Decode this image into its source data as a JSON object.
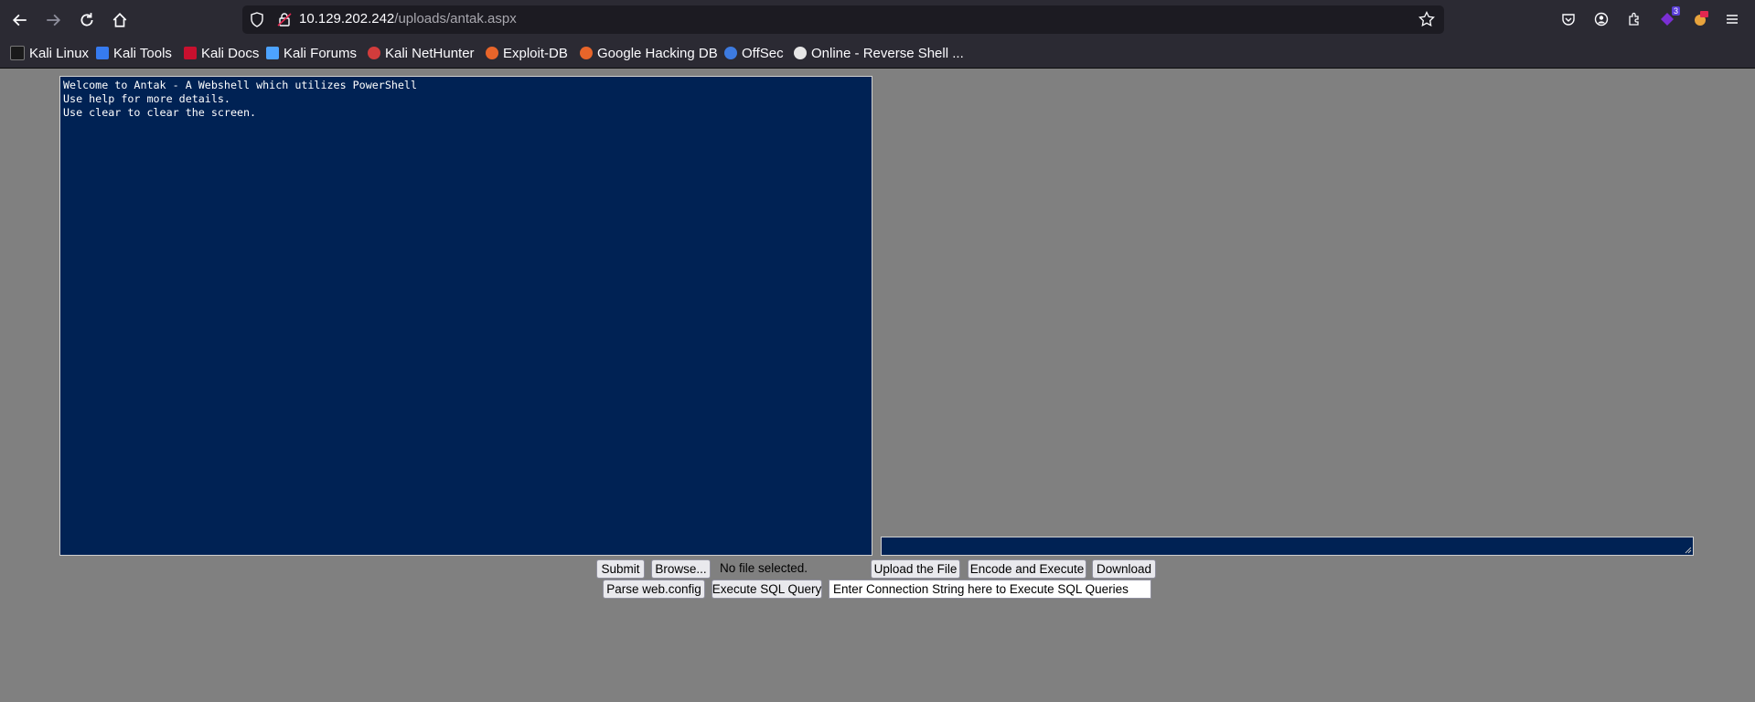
{
  "browser": {
    "url_host": "10.129.202.242",
    "url_path": "/uploads/antak.aspx",
    "extension_badge": "3",
    "bookmarks": [
      {
        "label": "Kali Linux",
        "icon": "kali-dragon-icon"
      },
      {
        "label": "Kali Tools",
        "icon": "kali-tools-icon"
      },
      {
        "label": "Kali Docs",
        "icon": "kali-docs-icon"
      },
      {
        "label": "Kali Forums",
        "icon": "kali-forums-icon"
      },
      {
        "label": "Kali NetHunter",
        "icon": "nethunter-icon"
      },
      {
        "label": "Exploit-DB",
        "icon": "exploit-db-icon"
      },
      {
        "label": "Google Hacking DB",
        "icon": "ghdb-icon"
      },
      {
        "label": "OffSec",
        "icon": "offsec-icon"
      },
      {
        "label": "Online - Reverse Shell ...",
        "icon": "skull-icon"
      }
    ]
  },
  "page": {
    "console_lines": [
      "Welcome to Antak - A Webshell which utilizes PowerShell",
      "Use help for more details.",
      "Use clear to clear the screen."
    ],
    "buttons": {
      "submit": "Submit",
      "browse": "Browse...",
      "upload": "Upload the File",
      "encode": "Encode and Execute",
      "download": "Download",
      "parse": "Parse web.config",
      "sql": "Execute SQL Query"
    },
    "file_status": "No file selected.",
    "sql_placeholder": "Enter Connection String here to Execute SQL Queries"
  },
  "colors": {
    "console_bg": "#002254",
    "page_bg": "#808080",
    "chrome_bg": "#2b2a33"
  }
}
